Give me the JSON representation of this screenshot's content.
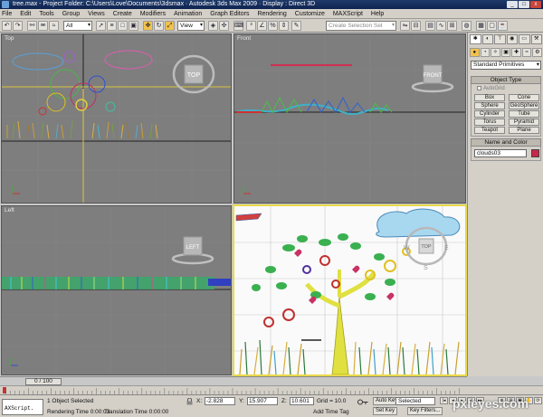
{
  "window": {
    "title": "tree.max   - Project Folder: C:\\Users\\Love\\Documents\\3dsmax   ·   Autodesk 3ds Max  2009      ·   Display : Direct 3D",
    "controls": [
      "_",
      "□",
      "x"
    ]
  },
  "menu": [
    "File",
    "Edit",
    "Tools",
    "Group",
    "Views",
    "Create",
    "Modifiers",
    "Animation",
    "Graph Editors",
    "Rendering",
    "Customize",
    "MAXScript",
    "Help"
  ],
  "toolbar": {
    "selection_filter": "All",
    "reference_coord": "View",
    "named_selection_placeholder": "Create Selection Set"
  },
  "viewports": {
    "top": {
      "label": "Top",
      "cube_label": "TOP"
    },
    "front": {
      "label": "Front",
      "cube_label": "FRONT"
    },
    "left": {
      "label": "Left",
      "cube_label": "LEFT"
    },
    "perspective": {
      "label": "",
      "cube_label": "TOP"
    }
  },
  "command_panel": {
    "category_dropdown": "Standard Primitives",
    "object_type_title": "Object Type",
    "autogrid_label": "AutoGrid",
    "primitives": [
      "Box",
      "Cone",
      "Sphere",
      "GeoSphere",
      "Cylinder",
      "Tube",
      "Torus",
      "Pyramid",
      "Teapot",
      "Plane"
    ],
    "name_color_title": "Name and Color",
    "object_name": "clouds03",
    "object_color": "#c8264a"
  },
  "timeline": {
    "frame_display": "0 / 100",
    "ticks": [
      "0",
      "5",
      "10",
      "15",
      "20",
      "25",
      "30",
      "35",
      "40",
      "45",
      "50",
      "55",
      "60",
      "65",
      "70",
      "75",
      "80",
      "85",
      "90",
      "95",
      "100"
    ]
  },
  "status": {
    "maxscript_label": "AXScript.",
    "selection_text": "1 Object Selected",
    "render_time": "Rendering Time  0:00:03",
    "translation_time": "Translation Time  0:00:00",
    "x_label": "X:",
    "x_value": "-2.828",
    "y_label": "Y:",
    "y_value": "15.907",
    "z_label": "Z:",
    "z_value": "10.601",
    "grid": "Grid = 10.0",
    "add_time_tag": "Add Time Tag",
    "auto_key": "Auto Key",
    "set_key": "Set Key",
    "key_mode": "Selected",
    "key_filters": "Key Filters..."
  },
  "watermark": "pxleyes.com"
}
